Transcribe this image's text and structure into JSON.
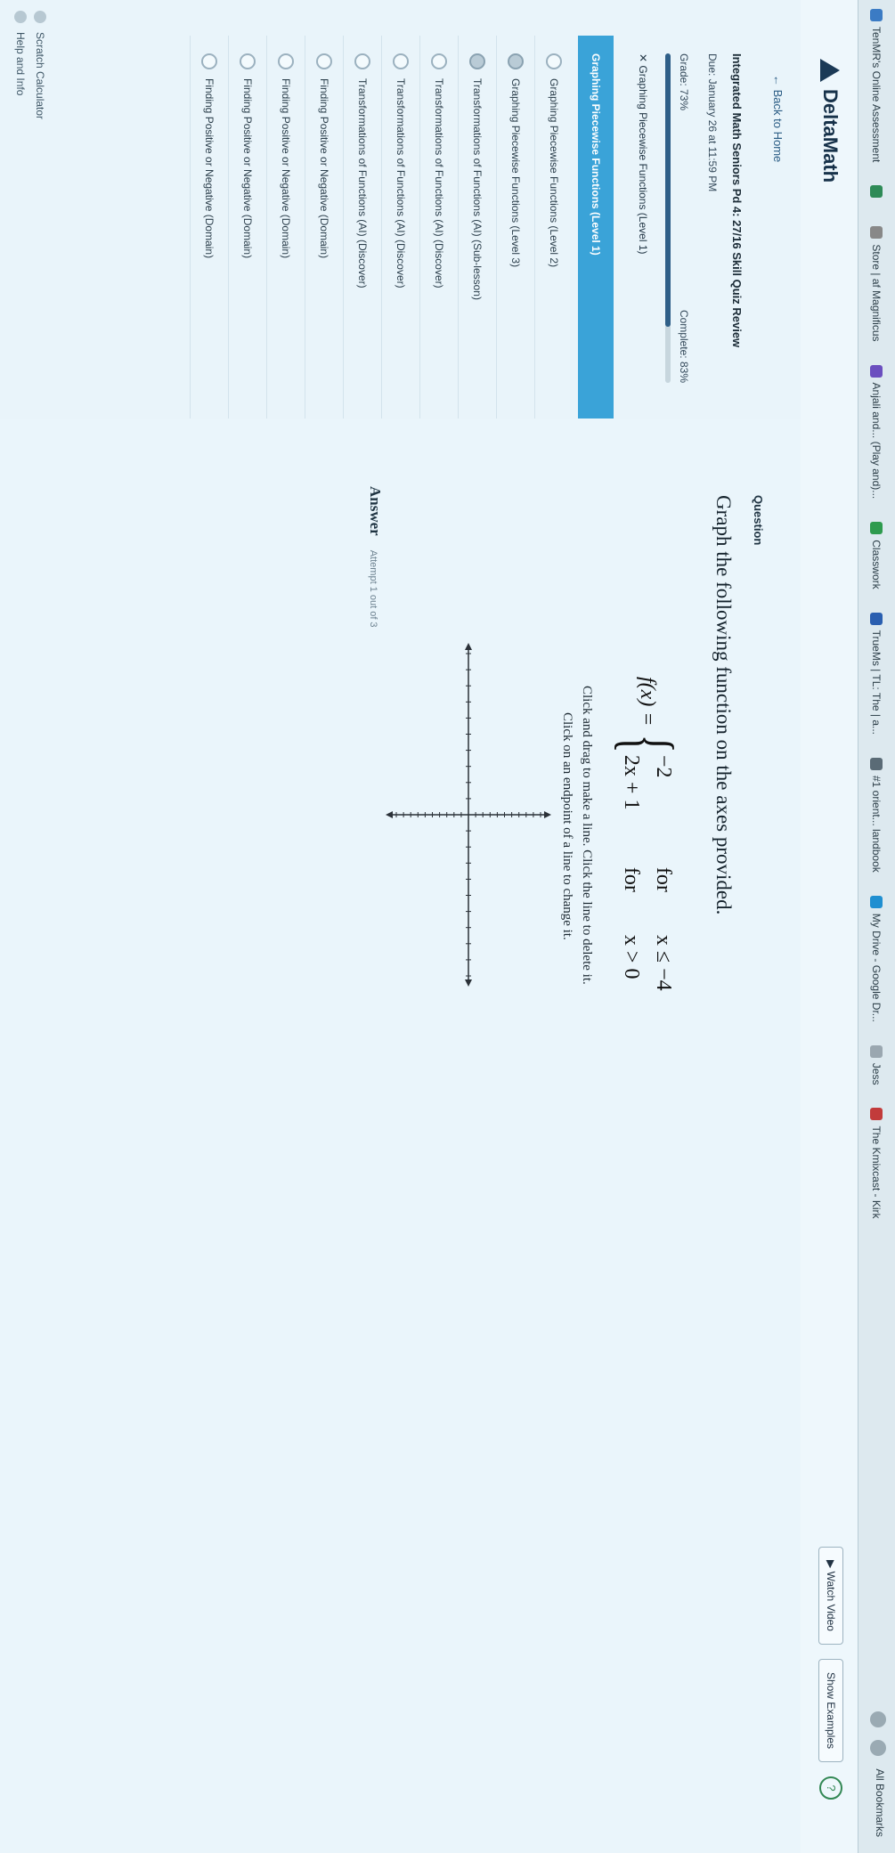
{
  "browser": {
    "bookmarks": [
      {
        "label": "TenMR's Online Assessment",
        "color": "#3b7bc4"
      },
      {
        "label": "",
        "color": "#2e8b57"
      },
      {
        "label": "Store | af Magnificus",
        "color": "#888888"
      },
      {
        "label": "Anjali and... (Play and)...",
        "color": "#6b4fbf"
      },
      {
        "label": "Classwork",
        "color": "#2e9b4e"
      },
      {
        "label": "TrueMs | TL: The | a...",
        "color": "#2a5fb0"
      },
      {
        "label": "#1 orient... landbook",
        "color": "#5a6b76"
      },
      {
        "label": "My Drive - Google Dr...",
        "color": "#1f8fd1"
      },
      {
        "label": "Jess",
        "color": "#9aa7b0"
      },
      {
        "label": "The Kmixcast - Kirk",
        "color": "#c23b3b"
      }
    ],
    "right_label": "All Bookmarks"
  },
  "header": {
    "logo_text": "DeltaMath",
    "watch_video_label": "Watch Video",
    "show_examples_label": "Show Examples",
    "help_label": "?"
  },
  "sidebar": {
    "back_label": "Back to Home",
    "assignment_title": "Integrated Math Seniors Pd 4: 27/16 Skill Quiz Review",
    "due_text": "Due: January 26 at 11:59 PM",
    "grade_text": "Grade: 73%",
    "completion_text": "Complete: 83%",
    "progress_pct": 83,
    "topic_text": "Graphing Piecewise Functions (Level 1)",
    "section_label": "Graphing Piecewise Functions (Level 1)",
    "skills": [
      {
        "label": "Graphing Piecewise Functions (Level 2)",
        "done": false
      },
      {
        "label": "Graphing Piecewise Functions (Level 3)",
        "done": true
      },
      {
        "label": "Transformations of Functions (AI) (Sub-lesson)",
        "done": true
      },
      {
        "label": "Transformations of Functions (AI) (Discover)",
        "done": false
      },
      {
        "label": "Transformations of Functions (AI) (Discover)",
        "done": false
      },
      {
        "label": "Transformations of Functions (AI) (Discover)",
        "done": false
      },
      {
        "label": "Finding Positive or Negative (Domain)",
        "done": false
      },
      {
        "label": "Finding Positive or Negative (Domain)",
        "done": false
      },
      {
        "label": "Finding Positive or Negative (Domain)",
        "done": false
      },
      {
        "label": "Finding Positive or Negative (Domain)",
        "done": false
      }
    ],
    "footer": [
      "Scratch Calculator",
      "Help and Info"
    ]
  },
  "main": {
    "question_label": "Question",
    "question_text": "Graph the following function on the axes provided.",
    "function_name": "f(x) =",
    "cases": [
      {
        "expr": "−2",
        "for": "for",
        "cond": "x ≤ −4"
      },
      {
        "expr": "2x + 1",
        "for": "for",
        "cond": "x > 0"
      }
    ],
    "instruction1": "Click and drag to make a line. Click the line to delete it.",
    "instruction2": "Click on an endpoint of a line to change it.",
    "answer_label": "Answer",
    "attempt_text": "Attempt 1 out of 3"
  },
  "graph": {
    "xlim": [
      -10,
      10
    ],
    "ylim": [
      -10,
      10
    ],
    "grid": false,
    "axis_color": "#2b3138",
    "tick_color": "#2b3138"
  }
}
